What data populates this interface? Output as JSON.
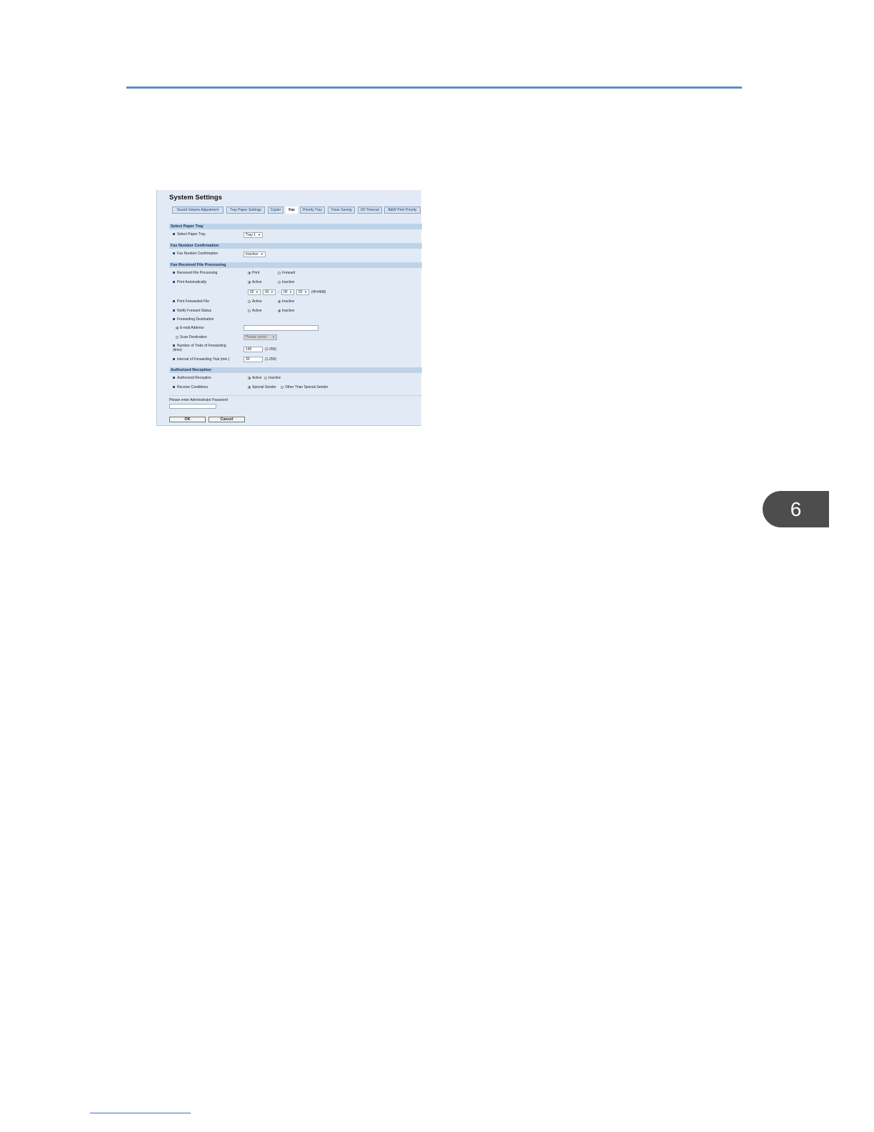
{
  "chapter_number": "6",
  "panel": {
    "title": "System Settings",
    "tabs": [
      {
        "label": "Sound Volume Adjustment",
        "active": false
      },
      {
        "label": "Tray Paper Settings",
        "active": false
      },
      {
        "label": "Copier",
        "active": false
      },
      {
        "label": "Fax",
        "active": true
      },
      {
        "label": "Priority Tray",
        "active": false
      },
      {
        "label": "Toner Saving",
        "active": false
      },
      {
        "label": "I/O Timeout",
        "active": false
      },
      {
        "label": "B&W Print Priority",
        "active": false
      }
    ],
    "sections": {
      "select_paper_tray": {
        "header": "Select Paper Tray",
        "select_paper_tray_label": "Select Paper Tray",
        "select_paper_tray_value": "Tray 1"
      },
      "fax_number_confirmation": {
        "header": "Fax Number Confirmation",
        "label": "Fax Number Confirmation",
        "value": "Inactive"
      },
      "fax_received_file_processing": {
        "header": "Fax Received File Processing",
        "received_file_processing_label": "Received File Processing",
        "received_print": "Print",
        "received_forward": "Forward",
        "print_automatically_label": "Print Automatically",
        "print_auto_active": "Active",
        "print_auto_inactive": "Inactive",
        "time_from_hh": "00",
        "time_from_mm": "00",
        "time_separator": "-",
        "time_to_hh": "00",
        "time_to_mm": "00",
        "time_unit": "(HH:MM)",
        "print_forwarded_file_label": "Print Forwarded File",
        "print_forwarded_active": "Active",
        "print_forwarded_inactive": "Inactive",
        "notify_forward_status_label": "Notify Forward Status",
        "notify_active": "Active",
        "notify_inactive": "Inactive",
        "forwarding_destination_label": "Forwarding Destination",
        "email_address_label": "E-mail Address",
        "email_address_value": "",
        "scan_destination_label": "Scan Destination",
        "scan_destination_value": "Please select",
        "trials_label_line1": "Number of Trials of Forwarding",
        "trials_label_line2": "(time)",
        "trials_value": "145",
        "trials_range": "(1-255)",
        "interval_label": "Interval of Forwarding Trial (min.)",
        "interval_value": "30",
        "interval_range": "(1-255)"
      },
      "authorized_reception": {
        "header": "Authorized Reception",
        "authorized_reception_label": "Authorized Reception",
        "auth_active": "Active",
        "auth_inactive": "Inactive",
        "receive_conditions_label": "Receive Conditions",
        "special_sender": "Special Sender",
        "other_than_special_sender": "Other Than Special Sender"
      }
    },
    "password_prompt": "Please enter Administrator Password",
    "password_value": "",
    "ok_label": "OK",
    "cancel_label": "Cancel"
  }
}
